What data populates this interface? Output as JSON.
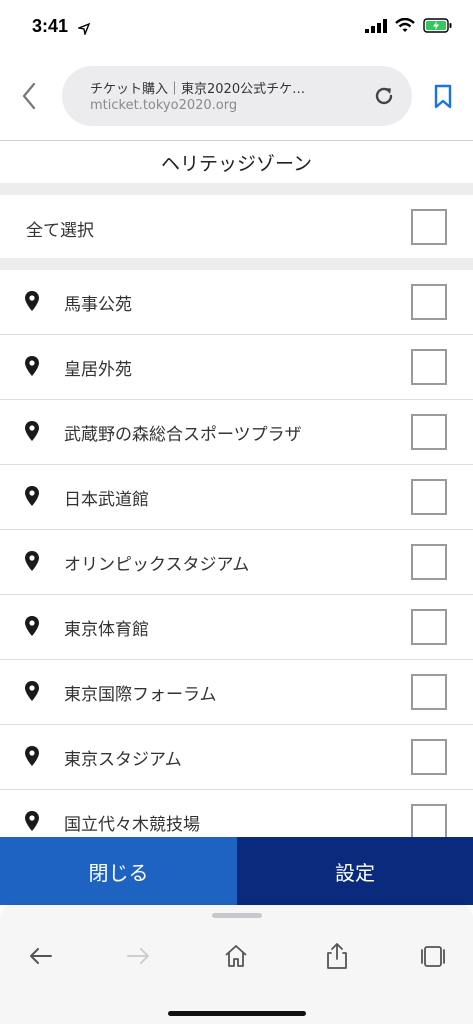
{
  "status_bar": {
    "time": "3:41",
    "icons": [
      "location-arrow-icon",
      "signal-icon",
      "wifi-icon",
      "battery-charging-icon"
    ]
  },
  "browser": {
    "page_title": "チケット購入｜東京2020公式チケ…",
    "host": "mticket.tokyo2020.org",
    "icons": [
      "back-chevron-icon",
      "reload-icon",
      "bookmark-icon"
    ]
  },
  "zone": {
    "title": "ヘリテッジゾーン"
  },
  "select_all": {
    "label": "全て選択",
    "checked": false
  },
  "venues": [
    {
      "label": "馬事公苑",
      "checked": false
    },
    {
      "label": "皇居外苑",
      "checked": false
    },
    {
      "label": "武蔵野の森総合スポーツプラザ",
      "checked": false
    },
    {
      "label": "日本武道館",
      "checked": false
    },
    {
      "label": "オリンピックスタジアム",
      "checked": false
    },
    {
      "label": "東京体育館",
      "checked": false
    },
    {
      "label": "東京国際フォーラム",
      "checked": false
    },
    {
      "label": "東京スタジアム",
      "checked": false
    },
    {
      "label": "国立代々木競技場",
      "checked": false
    }
  ],
  "actions": {
    "close_label": "閉じる",
    "set_label": "設定"
  },
  "colors": {
    "close_button": "#1e63c1",
    "set_button": "#0a2a7e",
    "bookmark": "#1a73e8",
    "battery": "#34c759"
  },
  "toolbar": {
    "icons": [
      "back-arrow-icon",
      "forward-arrow-icon",
      "home-icon",
      "share-icon",
      "tabs-icon"
    ]
  }
}
